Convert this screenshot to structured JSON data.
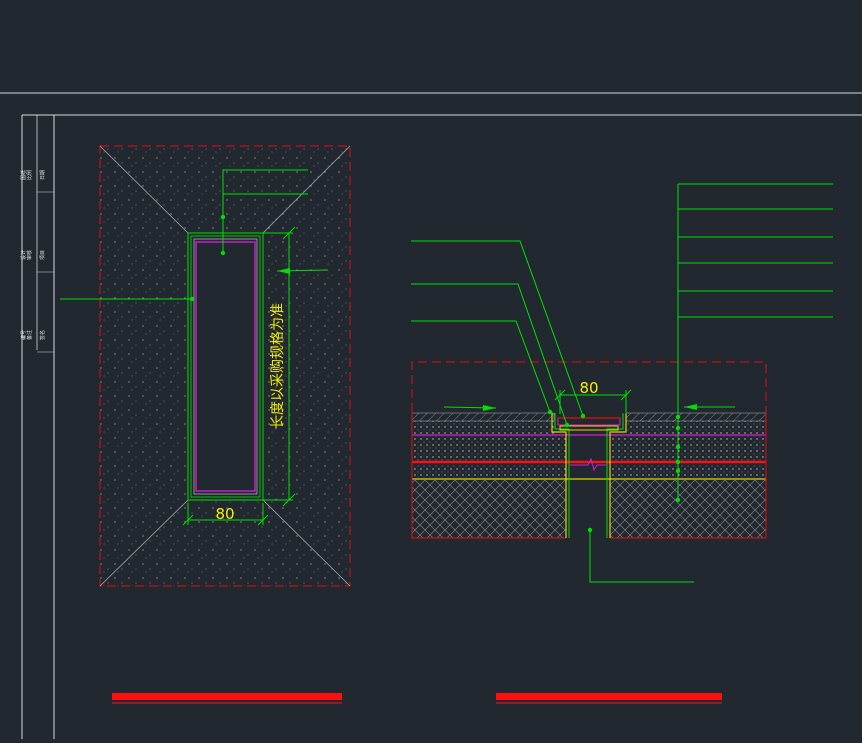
{
  "colors": {
    "background": "#212830",
    "frame": "#d9d9d9",
    "leader": "#00e000",
    "dashed_border": "#e01010",
    "dimension": "#f5f000",
    "inner_frame": "#d020d0",
    "red_bar": "#ff1010",
    "hatch": "#9a9a9a"
  },
  "plan_view": {
    "dimension_text": "80",
    "vertical_note": "长度以采购规格为准"
  },
  "section_view": {
    "dimension_text": "80"
  },
  "title_block": {
    "cells": [
      "图纸",
      "比例",
      "日期",
      "设计",
      "审核",
      "项目",
      "编号",
      "备注",
      "签名"
    ]
  }
}
